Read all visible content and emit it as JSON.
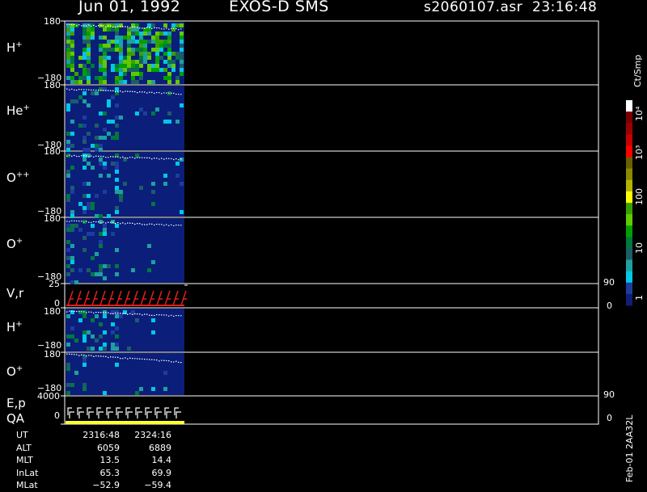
{
  "header": {
    "date": "Jun 01, 1992",
    "mission": "EXOS-D SMS",
    "file": "s2060107.asr",
    "time": "23:16:48"
  },
  "colors": {
    "background": "#000000",
    "panel_fill": "#0a1e7a",
    "frame": "#ffffff",
    "v_r_trace": "#e02020",
    "qa_bar": "#ffff30"
  },
  "colorbar": {
    "unit_label": "Ct/Smp",
    "tick_labels": [
      "10⁴",
      "10³",
      "100",
      "10",
      "1"
    ],
    "colors": [
      "#ffffff",
      "#7a0000",
      "#9c0000",
      "#c80000",
      "#ff0000",
      "#6a6000",
      "#8a8a00",
      "#b4b400",
      "#ffff00",
      "#3aa000",
      "#64c800",
      "#00a000",
      "#007840",
      "#1e5c68",
      "#1ea0a0",
      "#00c8e6",
      "#1e3ca0",
      "#101e78"
    ]
  },
  "panels": [
    {
      "id": "hplus",
      "species": "H",
      "charge": "+",
      "ytop": "180",
      "ybot": "−180"
    },
    {
      "id": "heplus",
      "species": "He",
      "charge": "+",
      "ytop": "180",
      "ybot": "−180"
    },
    {
      "id": "oplusplus",
      "species": "O",
      "charge": "++",
      "ytop": "180",
      "ybot": "−180"
    },
    {
      "id": "oplus",
      "species": "O",
      "charge": "+",
      "ytop": "180",
      "ybot": "−180"
    },
    {
      "id": "vr",
      "label": "V,r",
      "ytop": "25",
      "ybot": "0",
      "rtop": "90",
      "rbot": "0"
    },
    {
      "id": "hplus2",
      "species": "H",
      "charge": "+",
      "ytop": "180",
      "ybot": "−180"
    },
    {
      "id": "oplus2",
      "species": "O",
      "charge": "+",
      "ytop": "180",
      "ybot": "−180"
    },
    {
      "id": "ep",
      "label": "E,p",
      "label2": "QA",
      "ytop": "4000",
      "ybot": "0",
      "rtop": "90",
      "rbot": "0"
    }
  ],
  "footer": {
    "rows": [
      {
        "label": "UT",
        "v1": "2316:48",
        "v2": "2324:16"
      },
      {
        "label": "ALT",
        "v1": "6059",
        "v2": "6889"
      },
      {
        "label": "MLT",
        "v1": "13.5",
        "v2": "14.4"
      },
      {
        "label": "InLat",
        "v1": "65.3",
        "v2": "69.9"
      },
      {
        "label": "MLat",
        "v1": "−52.9",
        "v2": "−59.4"
      }
    ],
    "side_text": "Feb-01 2AA32L"
  }
}
